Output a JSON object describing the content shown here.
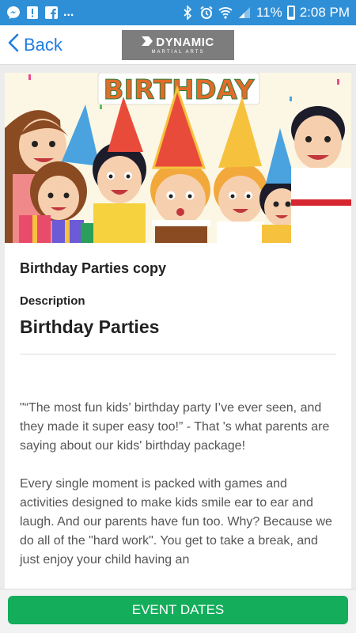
{
  "status_bar": {
    "battery": "11%",
    "time": "2:08 PM",
    "ellipsis": "..."
  },
  "nav": {
    "back_label": "Back",
    "logo_main": "DYNAMIC",
    "logo_sub": "MARTIAL ARTS"
  },
  "hero": {
    "banner_text": "BIRTHDAY"
  },
  "event": {
    "title": "Birthday Parties copy",
    "description_label": "Description",
    "description_heading": "Birthday Parties",
    "paragraphs": [
      "\"“The most fun kids’ birthday party I’ve ever seen, and they made it super easy too!” - That 's what parents are saying about our kids' birthday package!",
      "Every single moment is packed with games and activities designed to make kids smile ear to ear and laugh. And our parents have fun too. Why? Because we do all of the \"hard work\". You get to take a break, and just enjoy your child having an"
    ]
  },
  "footer": {
    "event_dates_label": "EVENT DATES"
  },
  "colors": {
    "status_bar": "#2e8fd6",
    "link": "#1e7ee0",
    "button": "#14ad5b"
  }
}
